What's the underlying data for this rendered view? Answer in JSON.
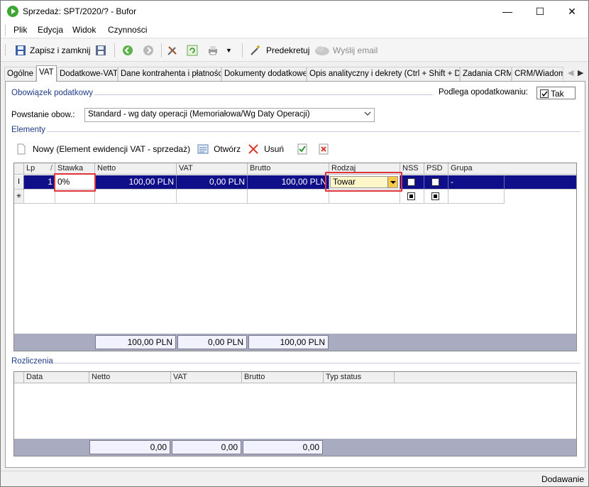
{
  "window": {
    "title": "Sprzedaż: SPT/2020/? - Bufor",
    "minimize_glyph": "—",
    "maximize_glyph": "☐",
    "close_glyph": "✕"
  },
  "menu": [
    "Plik",
    "Edycja",
    "Widok",
    "Czynności"
  ],
  "toolbar": {
    "save_close_label": "Zapisz i zamknij",
    "predekretuj_label": "Predekretuj",
    "send_email_label": "Wyślij email"
  },
  "tabs": [
    "Ogólne",
    "VAT",
    "Dodatkowe-VAT",
    "Dane kontrahenta i płatności",
    "Dokumenty dodatkowe",
    "Opis analityczny i dekrety (Ctrl + Shift + D)",
    "Zadania CRM",
    "CRM/Wiadomo"
  ],
  "active_tab": "VAT",
  "obowiazek": {
    "section_label": "Obowiązek podatkowy",
    "podlega_label": "Podlega opodatkowaniu:",
    "podlega_value": "Tak",
    "powstanie_label": "Powstanie obow.:",
    "powstanie_value": "Standard - wg daty operacji (Memoriałowa/Wg Daty Operacji)"
  },
  "elementy": {
    "section_label": "Elementy",
    "new_label": "Nowy (Element ewidencji VAT - sprzedaż)",
    "open_label": "Otwórz",
    "delete_label": "Usuń",
    "columns": [
      "Lp",
      "Stawka",
      "Netto",
      "VAT",
      "Brutto",
      "Rodzaj",
      "NSS",
      "PSD",
      "Grupa"
    ],
    "rows": [
      {
        "indicator": "I",
        "lp": "1",
        "stawka": "0%",
        "netto": "100,00 PLN",
        "vat": "0,00 PLN",
        "brutto": "100,00 PLN",
        "rodzaj": "Towar",
        "nss": false,
        "psd": false,
        "grupa": "-"
      }
    ],
    "new_row_indicator": "✳",
    "totals": {
      "netto": "100,00 PLN",
      "vat": "0,00 PLN",
      "brutto": "100,00 PLN"
    }
  },
  "rozliczenia": {
    "section_label": "Rozliczenia",
    "columns": [
      "Data",
      "Netto",
      "VAT",
      "Brutto",
      "Typ status"
    ],
    "totals": {
      "netto": "0,00",
      "vat": "0,00",
      "brutto": "0,00"
    }
  },
  "status": {
    "mode": "Dodawanie"
  },
  "colors": {
    "selection": "#0f0f8a",
    "highlight": "#e0353b",
    "section_text": "#1f3c88"
  }
}
